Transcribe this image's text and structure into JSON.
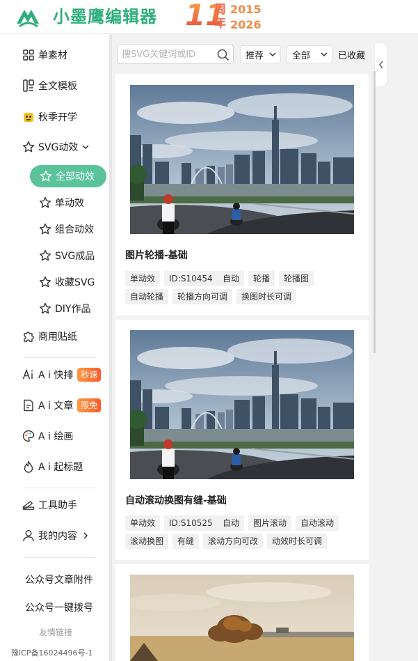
{
  "header": {
    "logo_text": "小墨鹰编辑器",
    "anniversary": {
      "number": "11",
      "word_top": "周",
      "word_bottom": "年",
      "year_start": "2015",
      "year_end": "2026"
    }
  },
  "sidebar": {
    "items": [
      {
        "label": "单素材",
        "icon": "grid-icon"
      },
      {
        "label": "全文模板",
        "icon": "template-icon"
      },
      {
        "label": "秋季开学",
        "icon": "mascot-icon"
      },
      {
        "label": "SVG动效",
        "icon": "star-icon"
      }
    ],
    "svg_sub_items": [
      {
        "label": "全部动效",
        "active": true
      },
      {
        "label": "单动效"
      },
      {
        "label": "组合动效"
      },
      {
        "label": "SVG成品"
      },
      {
        "label": "收藏SVG"
      },
      {
        "label": "DIY作品"
      }
    ],
    "stickers": "商用贴纸",
    "ai_items": [
      {
        "label": "A i 快排",
        "badge": "秒速"
      },
      {
        "label": "A i 文章",
        "badge": "限免"
      },
      {
        "label": "A i 绘画"
      },
      {
        "label": "A i 起标题"
      }
    ],
    "tools": "工具助手",
    "my_content": "我的内容",
    "links": [
      "公众号文章附件",
      "公众号一键拨号"
    ],
    "friend_links": "友情链接",
    "icp": "豫ICP备16024496号-1"
  },
  "toolbar": {
    "search_placeholder": "搜SVG关键词或ID",
    "sort": "推荐",
    "filter": "全部",
    "collected": "已收藏"
  },
  "cards": [
    {
      "title": "图片轮播-基础",
      "tags": [
        "单动效",
        "ID:S10454",
        "自动",
        "轮播",
        "轮播图",
        "自动轮播",
        "轮播方向可调",
        "换图时长可调"
      ]
    },
    {
      "title": "自动滚动换图有缝-基础",
      "tags": [
        "单动效",
        "ID:S10525",
        "自动",
        "图片滚动",
        "自动滚动",
        "滚动换图",
        "有缝",
        "滚动方向可改",
        "动效时长可调"
      ]
    }
  ],
  "colors": {
    "brand": "#2fae7e",
    "active": "#5ac39a",
    "badge": "#ff6a2f"
  }
}
